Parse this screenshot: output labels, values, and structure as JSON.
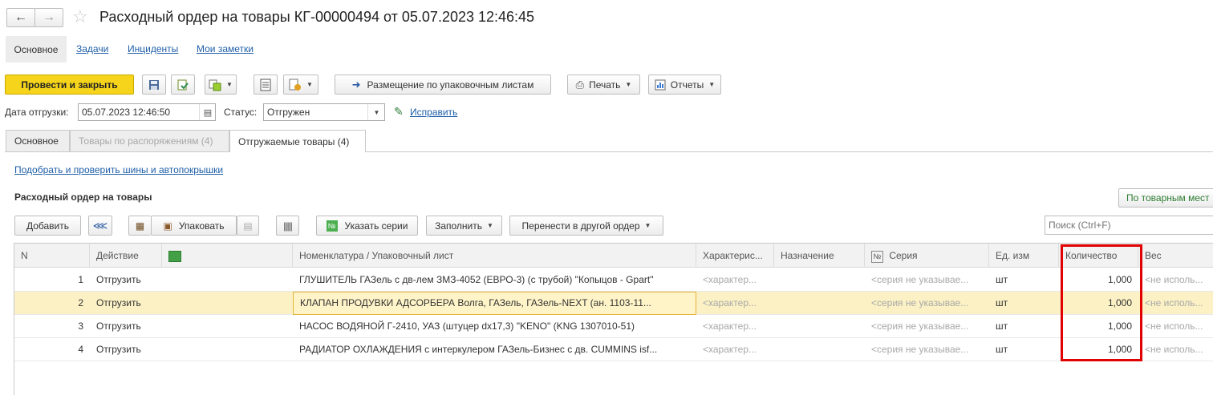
{
  "window": {
    "title": "Расходный ордер на товары КГ-00000494 от 05.07.2023 12:46:45"
  },
  "nav": {
    "items": [
      "Основное",
      "Задачи",
      "Инциденты",
      "Мои заметки"
    ]
  },
  "toolbar": {
    "post_close_label": "Провести и закрыть",
    "pack_sheets_label": "Размещение по упаковочным листам",
    "print_label": "Печать",
    "reports_label": "Отчеты"
  },
  "header_form": {
    "ship_date_label": "Дата отгрузки:",
    "ship_date_value": "05.07.2023 12:46:50",
    "status_label": "Статус:",
    "status_value": "Отгружен",
    "fix_link": "Исправить"
  },
  "tabs": [
    {
      "label": "Основное"
    },
    {
      "label": "Товары по распоряжениям (4)"
    },
    {
      "label": "Отгружаемые товары (4)"
    }
  ],
  "section": {
    "pick_tires_link": "Подобрать и проверить шины и автопокрышки",
    "title": "Расходный ордер на товары",
    "by_places_button": "По товарным мест"
  },
  "table_toolbar": {
    "add_label": "Добавить",
    "pack_label": "Упаковать",
    "set_series_label": "Указать серии",
    "fill_label": "Заполнить",
    "move_label": "Перенести в другой ордер",
    "search_placeholder": "Поиск (Ctrl+F)"
  },
  "table": {
    "columns": [
      "N",
      "Действие",
      "",
      "Номенклатура / Упаковочный лист",
      "Характерис...",
      "Назначение",
      "Серия",
      "Ед. изм",
      "Количество",
      "Вес"
    ],
    "rows": [
      {
        "n": "1",
        "action": "Отгрузить",
        "item": "ГЛУШИТЕЛЬ ГАЗель с дв-лем ЗМЗ-4052 (ЕВРО-3) (с трубой) \"Копыцов - Gpart\"",
        "char": "<характер...",
        "purpose": "",
        "series": "<серия не указывае...",
        "unit": "шт",
        "qty": "1,000",
        "weight": "<не исполь..."
      },
      {
        "n": "2",
        "action": "Отгрузить",
        "item": "КЛАПАН ПРОДУВКИ АДСОРБЕРА Волга, ГАЗель, ГАЗель-NEXT  (ан. 1103-11...",
        "char": "<характер...",
        "purpose": "",
        "series": "<серия не указывае...",
        "unit": "шт",
        "qty": "1,000",
        "weight": "<не исполь..."
      },
      {
        "n": "3",
        "action": "Отгрузить",
        "item": "НАСОС ВОДЯНОЙ Г-2410, УАЗ (штуцер dx17,3) \"KENO\" (KNG 1307010-51)",
        "char": "<характер...",
        "purpose": "",
        "series": "<серия не указывае...",
        "unit": "шт",
        "qty": "1,000",
        "weight": "<не исполь..."
      },
      {
        "n": "4",
        "action": "Отгрузить",
        "item": "РАДИАТОР ОХЛАЖДЕНИЯ с интеркулером ГАЗель-Бизнес с дв. CUMMINS isf...",
        "char": "<характер...",
        "purpose": "",
        "series": "<серия не указывае...",
        "unit": "шт",
        "qty": "1,000",
        "weight": "<не исполь..."
      }
    ]
  },
  "colors": {
    "primary_button": "#f5d41b",
    "selected_row": "#fbf1c4",
    "highlight_box": "#e00000",
    "link": "#1e5ea8"
  }
}
